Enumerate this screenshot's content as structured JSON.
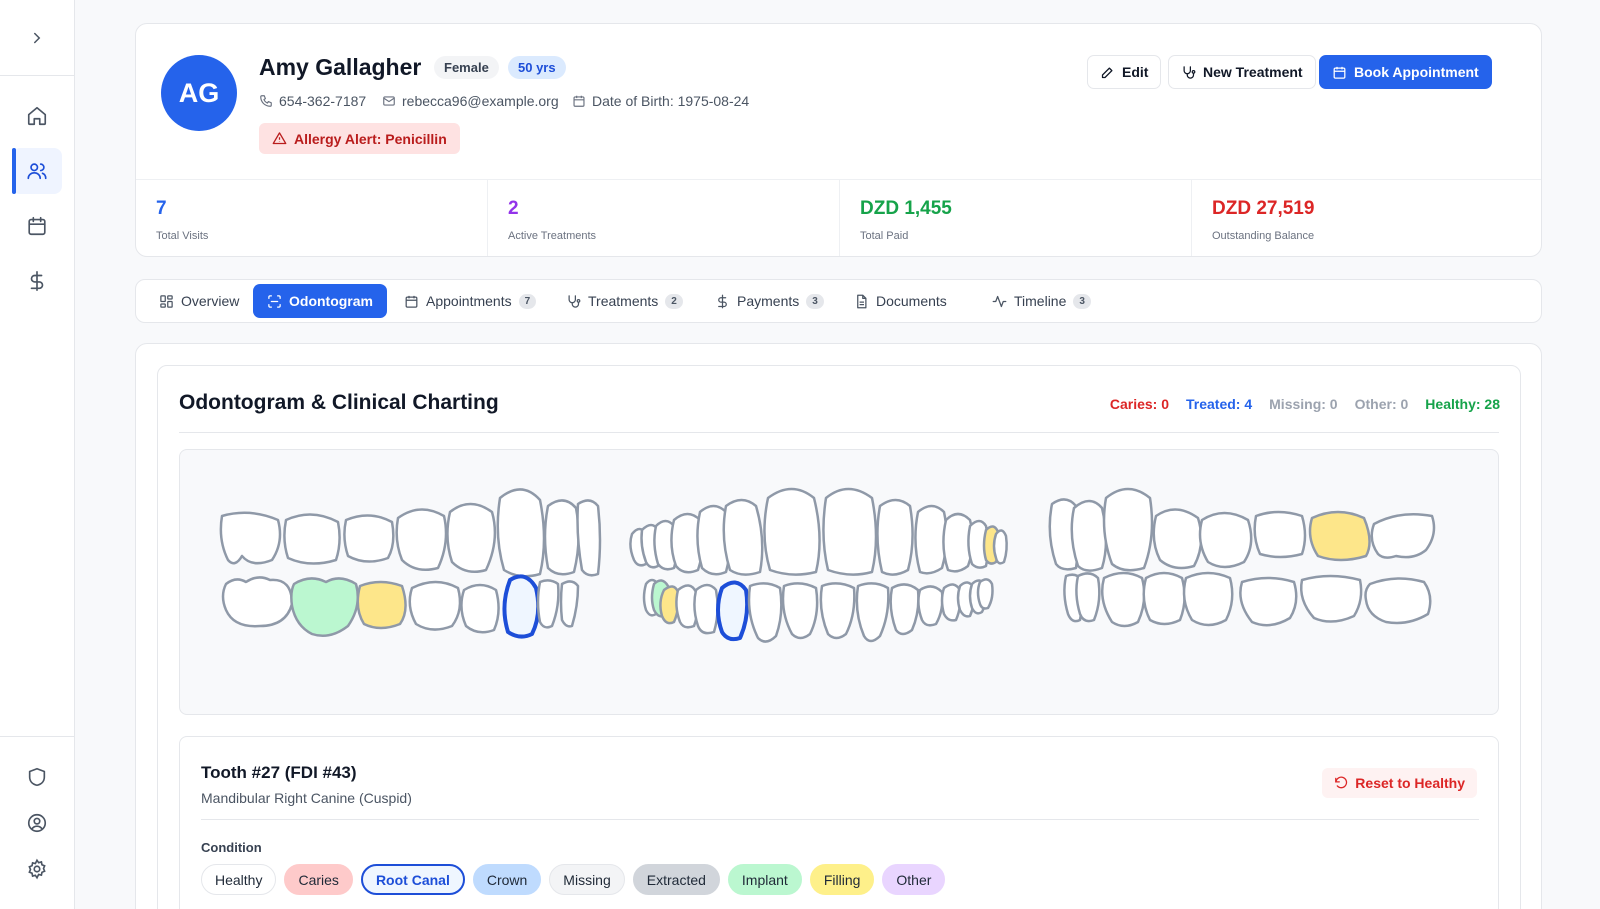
{
  "patient": {
    "initials": "AG",
    "name": "Amy Gallagher",
    "gender": "Female",
    "age": "50 yrs",
    "phone": "654-362-7187",
    "email": "rebecca96@example.org",
    "dob": "Date of Birth: 1975-08-24",
    "allergy": "Allergy Alert: Penicillin"
  },
  "actions": {
    "edit": "Edit",
    "new_treatment": "New Treatment",
    "book": "Book Appointment"
  },
  "stats": [
    {
      "value": "7",
      "label": "Total Visits",
      "color": "#2563eb"
    },
    {
      "value": "2",
      "label": "Active Treatments",
      "color": "#9333ea"
    },
    {
      "value": "DZD 1,455",
      "label": "Total Paid",
      "color": "#16a34a"
    },
    {
      "value": "DZD 27,519",
      "label": "Outstanding Balance",
      "color": "#dc2626"
    }
  ],
  "tabs": [
    {
      "label": "Overview",
      "icon": "grid-icon"
    },
    {
      "label": "Odontogram",
      "icon": "scan-icon",
      "active": true
    },
    {
      "label": "Appointments",
      "count": "7",
      "icon": "calendar-icon"
    },
    {
      "label": "Treatments",
      "count": "2",
      "icon": "stethoscope-icon"
    },
    {
      "label": "Payments",
      "count": "3",
      "icon": "dollar-icon"
    },
    {
      "label": "Documents",
      "icon": "file-icon"
    },
    {
      "label": "Timeline",
      "count": "3",
      "icon": "activity-icon"
    }
  ],
  "odontogram": {
    "title": "Odontogram & Clinical Charting",
    "summary": {
      "caries": "Caries: 0",
      "treated": "Treated: 4",
      "missing": "Missing: 0",
      "other": "Other: 0",
      "healthy": "Healthy: 28"
    }
  },
  "tooth_detail": {
    "title": "Tooth #27 (FDI #43)",
    "subtitle": "Mandibular Right Canine (Cuspid)",
    "reset": "Reset to Healthy",
    "condition_label": "Condition",
    "conditions": [
      {
        "label": "Healthy",
        "bg": "#ffffff",
        "border": "#e5e7eb"
      },
      {
        "label": "Caries",
        "bg": "#fecaca",
        "border": "#fecaca"
      },
      {
        "label": "Root Canal",
        "bg": "#eff6ff",
        "border": "#1d4ed8",
        "selected": true
      },
      {
        "label": "Crown",
        "bg": "#bfdbfe",
        "border": "#bfdbfe"
      },
      {
        "label": "Missing",
        "bg": "#f3f4f6",
        "border": "#e5e7eb"
      },
      {
        "label": "Extracted",
        "bg": "#d1d5db",
        "border": "#d1d5db"
      },
      {
        "label": "Implant",
        "bg": "#bbf7d0",
        "border": "#bbf7d0"
      },
      {
        "label": "Filling",
        "bg": "#fef08a",
        "border": "#fef08a"
      },
      {
        "label": "Other",
        "bg": "#e9d5ff",
        "border": "#e9d5ff"
      }
    ]
  }
}
